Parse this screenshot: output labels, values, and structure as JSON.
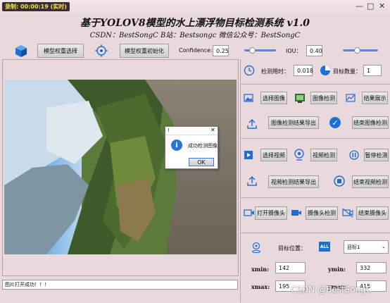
{
  "recording": {
    "label": "录制: 00:00:19 (实时)"
  },
  "header": {
    "title": "基于YOLOV8模型的水上漂浮物目标检测系统 v1.0",
    "subtitle": "CSDN：BestSongC   B站：Bestsongc   微信公众号：BestSongC"
  },
  "toolbar": {
    "model_select": "模型权重选择",
    "model_init": "模型权重初始化",
    "confidence_label": "Confidence:",
    "confidence_value": "0.25",
    "confidence_level": 0.25,
    "iou_label": "IOU：",
    "iou_value": "0.40",
    "iou_level": 0.4
  },
  "stats": {
    "time_label": "检测用时：",
    "time_value": "0.018",
    "count_label": "目标数量：",
    "count_value": "1"
  },
  "image_section": {
    "select": "选择图像",
    "detect": "图像检测",
    "show": "结果展示",
    "export": "图像检测结果导出",
    "end": "结束图像检测"
  },
  "video_section": {
    "select": "选择视频",
    "detect": "视频检测",
    "pause": "暂停检测",
    "export": "视频检测结果导出",
    "end": "结束视频检测"
  },
  "camera_section": {
    "open": "打开摄像头",
    "detect": "摄像头检测",
    "close": "结束摄像头"
  },
  "target": {
    "label": "目标位置：",
    "all_badge": "ALL",
    "selected": "目标1",
    "xmin_label": "xmin:",
    "xmin_value": "142",
    "ymin_label": "ymin:",
    "ymin_value": "332",
    "xmax_label": "xmax:",
    "xmax_value": "195",
    "ymax_label": "ymax:",
    "ymax_value": "415"
  },
  "dialog": {
    "title": "!",
    "message": "成功检测图像",
    "ok": "OK"
  },
  "status_bar": {
    "text": "图片打开成功！！！"
  },
  "watermark": {
    "text": "CSDN @BestSongC"
  },
  "colors": {
    "background": "#e9d8dc",
    "accent": "#2a7bd8",
    "slider": "#5a86d8"
  }
}
